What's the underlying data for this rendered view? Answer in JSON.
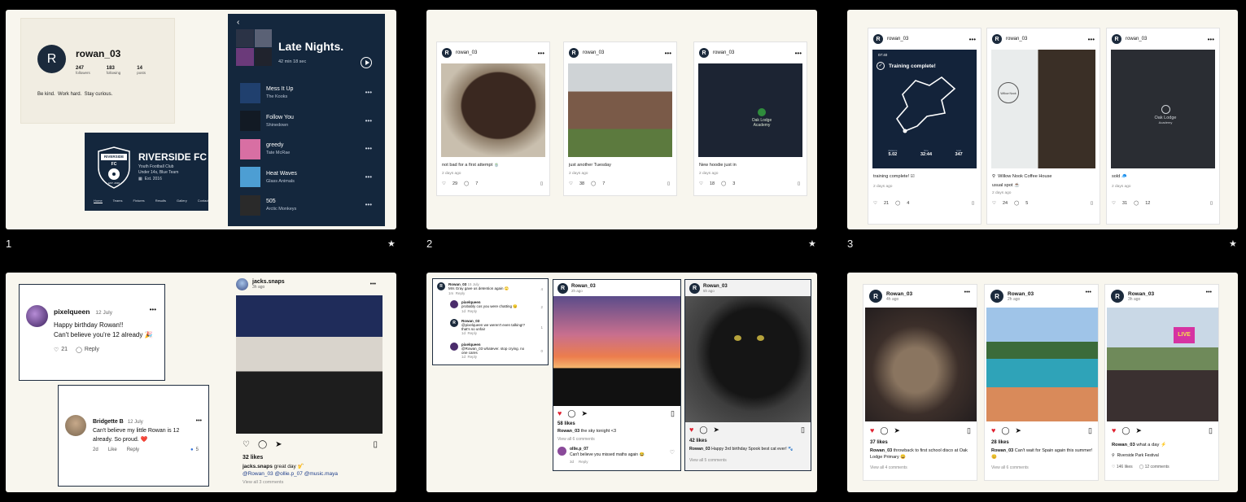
{
  "slides": [
    {
      "number": "1",
      "star": "★",
      "profile": {
        "avatar_letter": "R",
        "username": "rowan_03",
        "stats": [
          {
            "value": "247",
            "label": "followers"
          },
          {
            "value": "183",
            "label": "following"
          },
          {
            "value": "14",
            "label": "posts"
          }
        ],
        "bio": "Be kind.  Work hard.  Stay curious."
      },
      "club": {
        "badge_top": "RIVERSIDE",
        "badge_fc": "FC",
        "badge_bottom": "EST. 2016",
        "name": "RIVERSIDE FC",
        "line1": "Youth Football Club",
        "line2": "Under 14s, Blue Team",
        "est": "Est. 2016",
        "nav": [
          "Home",
          "Teams",
          "Fixtures",
          "Results",
          "Gallery",
          "Contact"
        ]
      },
      "playlist": {
        "back_icon": "chevron-left-icon",
        "title": "Late Nights.",
        "duration": "42 min 18 sec",
        "play_icon": "play-icon",
        "tracks": [
          {
            "title": "Mess It Up",
            "artist": "The Kooks",
            "color": "#20406e"
          },
          {
            "title": "Follow You",
            "artist": "Shinedown",
            "color": "#121a24"
          },
          {
            "title": "greedy",
            "artist": "Tate McRae",
            "color": "#d86fa3"
          },
          {
            "title": "Heat Waves",
            "artist": "Glass Animals",
            "color": "#4d9ed3"
          },
          {
            "title": "505",
            "artist": "Arctic Monkeys",
            "color": "#2a2a2a"
          }
        ]
      }
    },
    {
      "number": "2",
      "star": "★",
      "posts": [
        {
          "user": "rowan_03",
          "caption": "not bad for a first attempt 🍵",
          "ago": "2 days ago",
          "likes": "29",
          "comments": "7"
        },
        {
          "user": "rowan_03",
          "caption": "just another Tuesday",
          "ago": "2 days ago",
          "likes": "38",
          "comments": "7"
        },
        {
          "user": "rowan_03",
          "caption": "New hoodie just in",
          "ago": "2 days ago",
          "likes": "18",
          "comments": "3"
        }
      ],
      "hoodie_logo_line1": "Oak Lodge",
      "hoodie_logo_line2": "Academy"
    },
    {
      "number": "3",
      "star": "★",
      "posts": [
        {
          "user": "rowan_03",
          "caption": "training complete! ☑",
          "ago": "2 days ago",
          "likes": "21",
          "comments": "4"
        },
        {
          "user": "rowan_03",
          "location": "Willow Nook Coffee House",
          "caption": "usual spot ☕",
          "ago": "2 days ago",
          "likes": "24",
          "comments": "5"
        },
        {
          "user": "rowan_03",
          "caption": "sold 🧢",
          "ago": "2 days ago",
          "likes": "31",
          "comments": "12"
        }
      ],
      "run": {
        "time": "07:40",
        "headline": "Training complete!",
        "stats": [
          {
            "label": "distance",
            "value": "5.02"
          },
          {
            "label": "time",
            "value": "32:44"
          },
          {
            "label": "kcal",
            "value": "347"
          }
        ]
      },
      "coffee_sign": "Willow Nook",
      "hoodie_logo_line1": "Oak Lodge",
      "hoodie_logo_line2": "Academy"
    },
    {
      "number": "4",
      "comment1": {
        "user": "pixelqueen",
        "date": "12 July",
        "line1": "Happy birthday Rowan!!",
        "line2": "Can't believe you're 12 already 🎉",
        "likes": "21",
        "reply": "Reply"
      },
      "comment2": {
        "user": "Bridgette B",
        "date": "12 July",
        "line1": "Can't believe my little Rowan is 12",
        "line2": "already.  So proud. ❤️",
        "age": "2d",
        "like": "Like",
        "reply": "Reply",
        "reacts": "5"
      },
      "post": {
        "user": "jacks.snaps",
        "ago": "3h ago",
        "likes": "32 likes",
        "caption_user": "jacks.snaps",
        "caption": "great day 🎷",
        "tags": "@Rowan_03 @ollie.p_07 @music.maya",
        "view": "View all 3 comments"
      }
    },
    {
      "number": "5",
      "thread": [
        {
          "user": "Rowan_03",
          "time": "15 July",
          "text": "Mrs Gray gave us detention again 🙄",
          "sub": "1m  Reply",
          "likes": "4"
        },
        {
          "user": "pixelqueen",
          "time": "",
          "text": "probably cos you were chatting 😏",
          "sub": "1d  Reply",
          "likes": "2"
        },
        {
          "user": "Rowan_03",
          "time": "",
          "text": "@pixelqueen we weren't even talking!? that's so unfair",
          "sub": "1d  Reply",
          "likes": "1"
        },
        {
          "user": "pixelqueen",
          "time": "",
          "text": "@Rowan_03 whatever. stop crying. no one cares",
          "sub": "1d  Reply",
          "likes": "0"
        }
      ],
      "sunset": {
        "user": "Rowan_03",
        "ago": "2h ago",
        "likes": "58 likes",
        "caption_user": "Rowan_03",
        "caption": "the sky tonight <3",
        "view": "View all 6 comments",
        "reply_user": "ollie.p_07",
        "reply_text": "Can't believe you missed maths again 😂",
        "reply_age": "3d",
        "reply_label": "Reply"
      },
      "cat": {
        "user": "Rowan_03",
        "ago": "5h ago",
        "likes": "42 likes",
        "caption_user": "Rowan_03",
        "caption": "Happy 3rd birthday Spook best cat ever! 🐾",
        "view": "View all 5 comments"
      }
    },
    {
      "number": "6",
      "posts": [
        {
          "user": "Rowan_03",
          "ago": "4h ago",
          "likes": "37 likes",
          "caption_user": "Rowan_03",
          "caption": "throwback to first school disco at Oak Lodge Primary 😄",
          "view": "View all 4 comments"
        },
        {
          "user": "Rowan_03",
          "ago": "2h ago",
          "likes": "28 likes",
          "caption_user": "Rowan_03",
          "caption": "Can't wait for Spain again this summer! 😊",
          "view": "View all 6 comments"
        },
        {
          "user": "Rowan_03",
          "ago": "3h ago",
          "likes": "",
          "caption_user": "Rowan_03",
          "caption": "what a day ⚡",
          "location": "Riverside Park Festival",
          "likes_count": "146 likes",
          "comments_count": "12 comments",
          "stage_sign": "LIVE"
        }
      ]
    }
  ],
  "accent_red": "#e0202f",
  "navy": "#14273d"
}
